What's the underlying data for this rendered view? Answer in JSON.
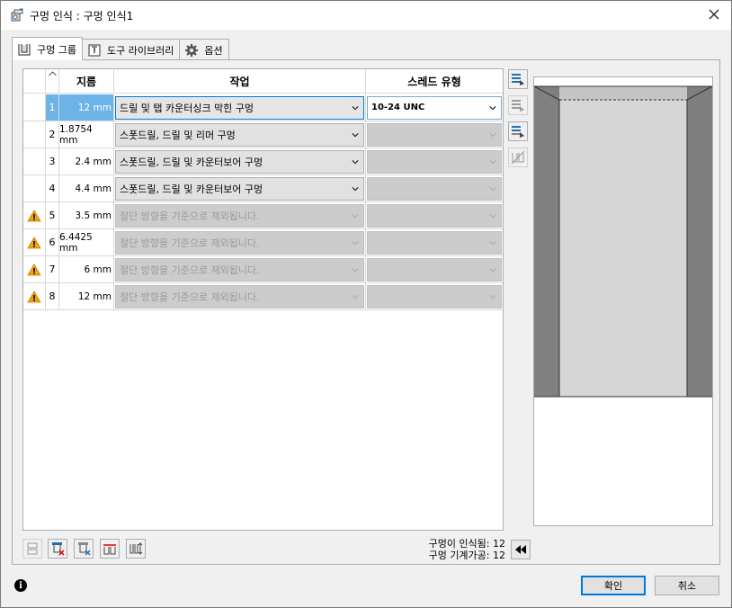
{
  "window": {
    "title": "구멍 인식 : 구멍 인식1"
  },
  "tabs": [
    {
      "label": "구멍 그룹",
      "icon": "hole-group-icon",
      "active": true
    },
    {
      "label": "도구 라이브러리",
      "icon": "tool-library-icon",
      "active": false
    },
    {
      "label": "옵션",
      "icon": "gear-icon",
      "active": false
    }
  ],
  "grid": {
    "columns": {
      "diameter": "지름",
      "operation": "작업",
      "thread": "스레드 유형"
    },
    "rows": [
      {
        "num": "1",
        "diameter": "12 mm",
        "operation": "드릴 및 탭 카운터싱크 막힌 구멍",
        "thread": "10-24 UNC",
        "warning": false,
        "selected": true,
        "excluded": false
      },
      {
        "num": "2",
        "diameter": "1.8754 mm",
        "operation": "스폿드릴, 드릴 및 리머 구멍",
        "thread": "",
        "warning": false,
        "selected": false,
        "excluded": false
      },
      {
        "num": "3",
        "diameter": "2.4 mm",
        "operation": "스폿드릴, 드릴 및 카운터보어 구멍",
        "thread": "",
        "warning": false,
        "selected": false,
        "excluded": false
      },
      {
        "num": "4",
        "diameter": "4.4 mm",
        "operation": "스폿드릴, 드릴 및 카운터보어 구멍",
        "thread": "",
        "warning": false,
        "selected": false,
        "excluded": false
      },
      {
        "num": "5",
        "diameter": "3.5 mm",
        "operation": "절단 방향을 기준으로 제외됩니다.",
        "thread": "",
        "warning": true,
        "selected": false,
        "excluded": true
      },
      {
        "num": "6",
        "diameter": "6.4425 mm",
        "operation": "절단 방향을 기준으로 제외됩니다.",
        "thread": "",
        "warning": true,
        "selected": false,
        "excluded": true
      },
      {
        "num": "7",
        "diameter": "6 mm",
        "operation": "절단 방향을 기준으로 제외됩니다.",
        "thread": "",
        "warning": true,
        "selected": false,
        "excluded": true
      },
      {
        "num": "8",
        "diameter": "12 mm",
        "operation": "절단 방향을 기준으로 제외됩니다.",
        "thread": "",
        "warning": true,
        "selected": false,
        "excluded": true
      }
    ]
  },
  "status": {
    "recognized": "구멍이 인식됨: 12",
    "machinable": "구멍 기계가공: 12"
  },
  "buttons": {
    "ok": "확인",
    "cancel": "취소"
  },
  "colors": {
    "selection": "#6cb4e8",
    "focus": "#0078d7",
    "warning": "#f0a30a"
  }
}
